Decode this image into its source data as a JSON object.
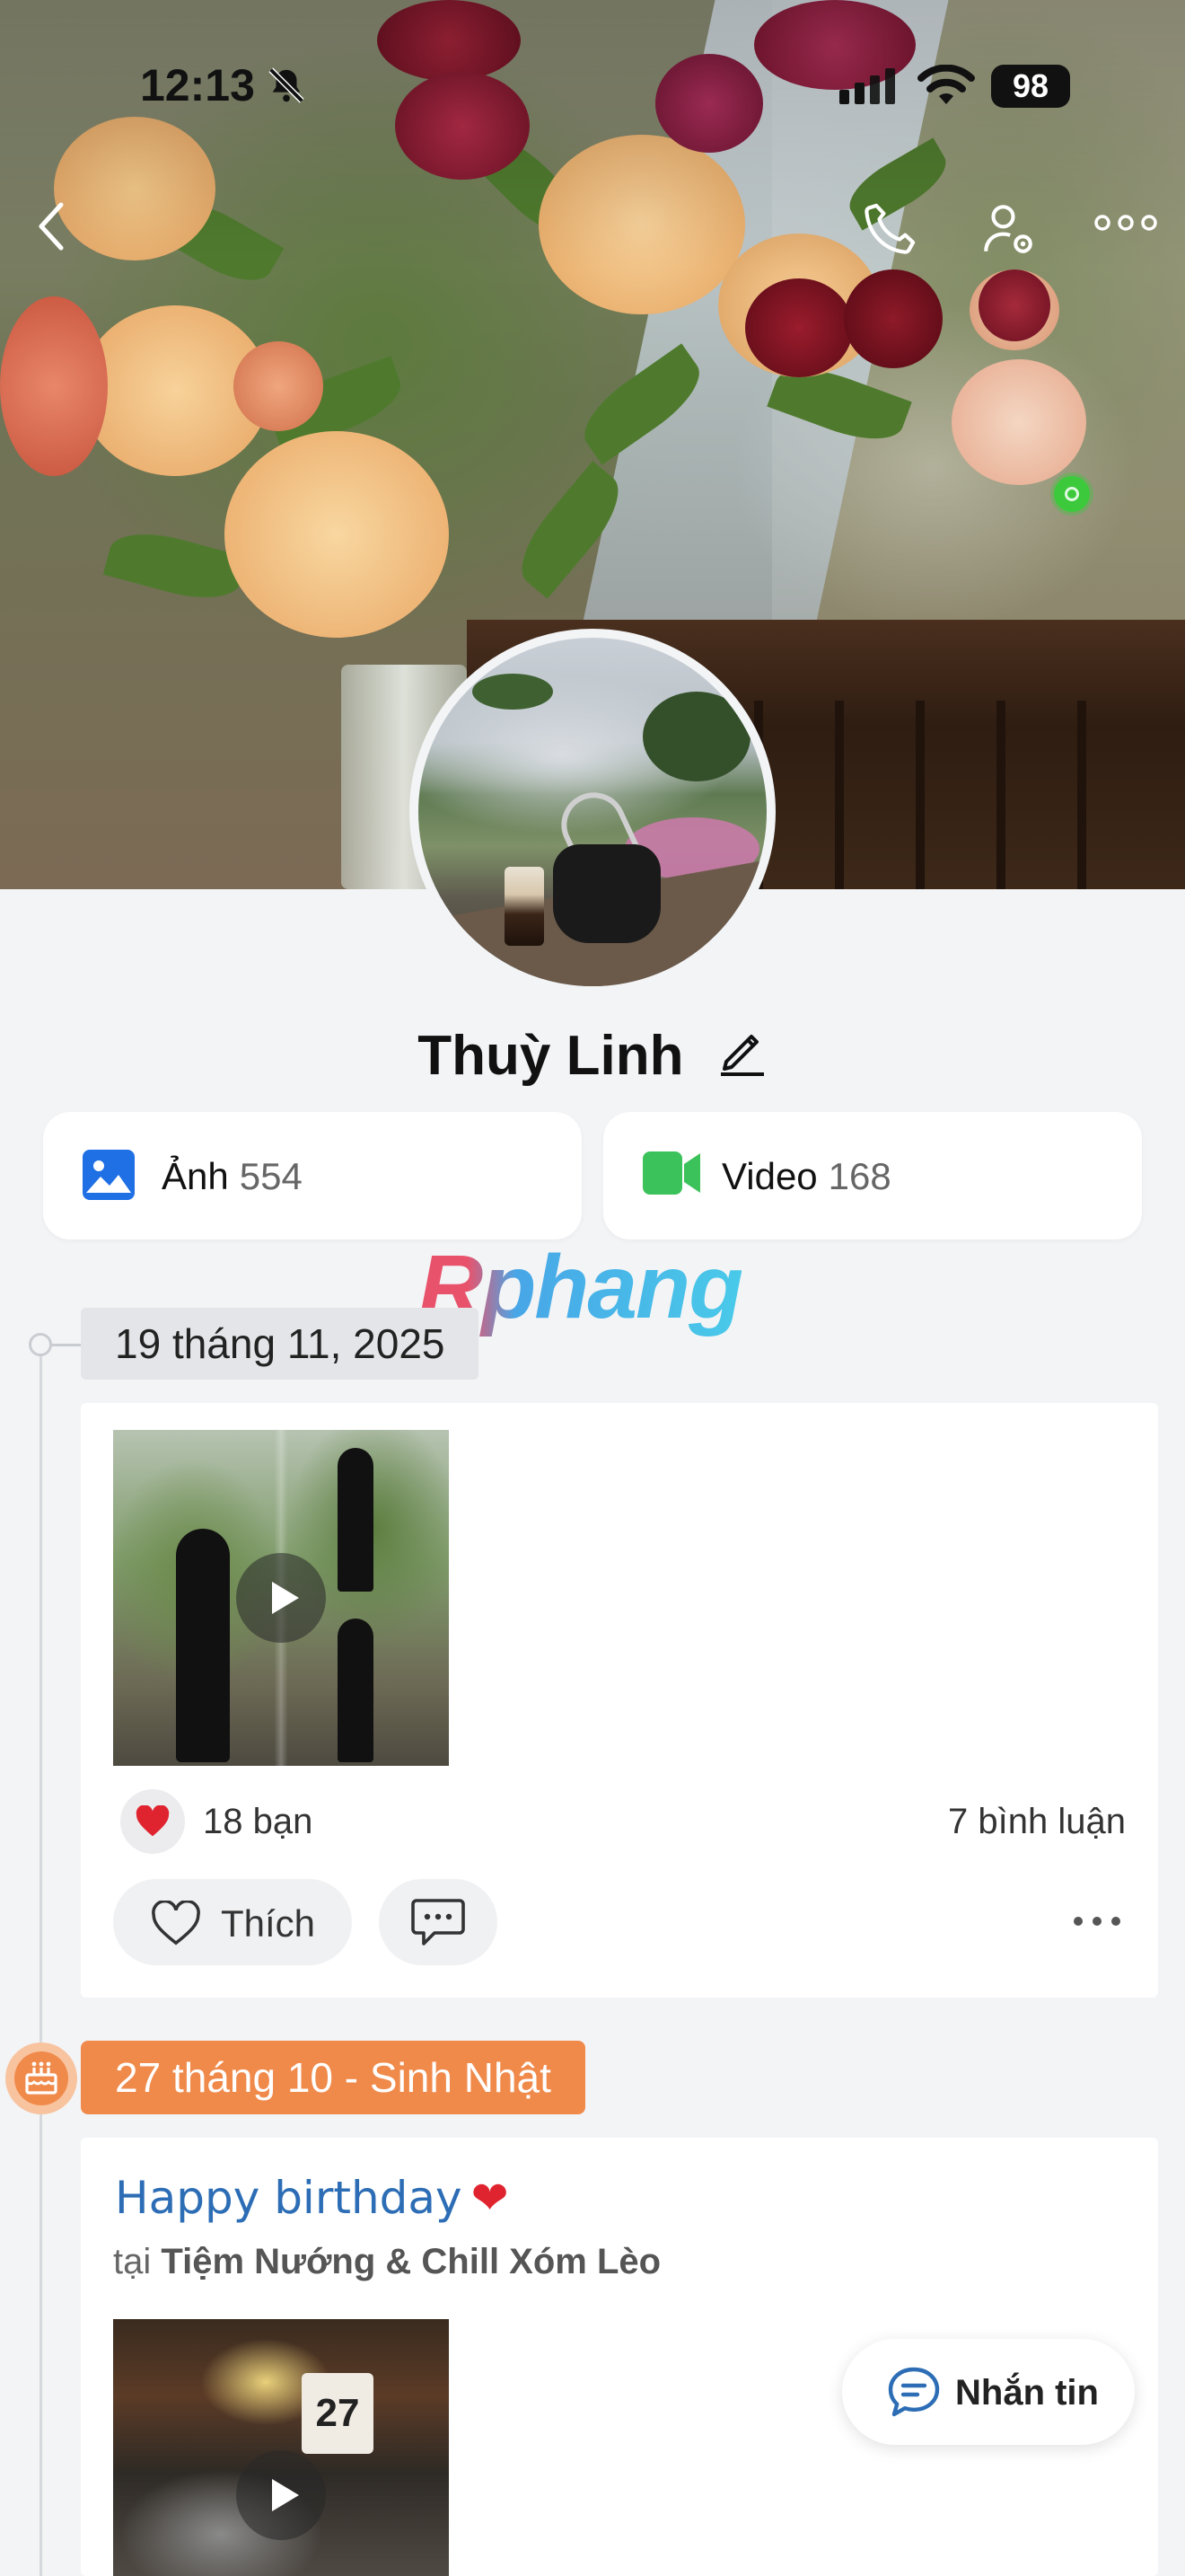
{
  "status_bar": {
    "time": "12:13",
    "battery": "98",
    "icons": [
      "bell-slash-icon",
      "cellular-signal-icon",
      "wifi-icon",
      "battery-icon"
    ]
  },
  "nav": {
    "icons": [
      "back-icon",
      "phone-icon",
      "profile-settings-icon",
      "more-icon"
    ]
  },
  "profile": {
    "name": "Thuỳ Linh",
    "online": true
  },
  "media": {
    "photos": {
      "label": "Ảnh",
      "count": "554",
      "icon": "image-icon",
      "color": "#1f6fe5"
    },
    "videos": {
      "label": "Video",
      "count": "168",
      "icon": "video-icon",
      "color": "#3cc25a"
    }
  },
  "watermark": "Rphang",
  "timeline": {
    "post1": {
      "date": "19 tháng 11, 2025",
      "reactions": "18 bạn",
      "comments": "7 bình luận",
      "like_label": "Thích"
    },
    "birthday": {
      "label": "27 tháng 10 - Sinh Nhật",
      "color": "#f08a4b"
    },
    "post2": {
      "title": "Happy birthday",
      "title_emoji": "❤️",
      "location_prefix": "tại",
      "location": "Tiệm Nướng & Chill Xóm Lèo",
      "calendar_day": "27"
    }
  },
  "message_button": {
    "label": "Nhắn tin"
  }
}
